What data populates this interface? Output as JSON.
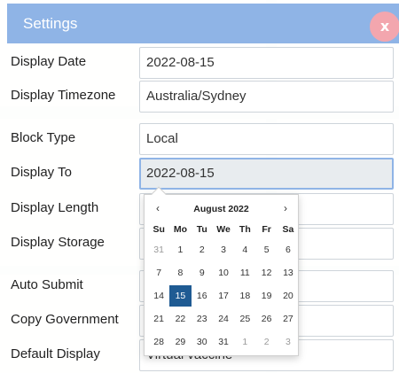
{
  "dialog": {
    "title": "Settings",
    "close_label": "x"
  },
  "fields": [
    {
      "name": "display-date",
      "label": "Display Date",
      "value": "2022-08-15"
    },
    {
      "name": "display-timezone",
      "label": "Display Timezone",
      "value": "Australia/Sydney"
    },
    {
      "name": "block-type",
      "label": "Block Type",
      "value": "Local"
    },
    {
      "name": "display-to",
      "label": "Display To",
      "value": "2022-08-15"
    },
    {
      "name": "display-length",
      "label": "Display Length",
      "value": ""
    },
    {
      "name": "display-storage",
      "label": "Display Storage",
      "value": ""
    },
    {
      "name": "auto-submit",
      "label": "Auto Submit",
      "value": ""
    },
    {
      "name": "copy-government",
      "label": "Copy Government",
      "value": ""
    },
    {
      "name": "default-display",
      "label": "Default Display",
      "value": "Virtual vaccine"
    }
  ],
  "datepicker": {
    "prev": "‹",
    "next": "›",
    "month_label": "August 2022",
    "weekdays": [
      "Su",
      "Mo",
      "Tu",
      "We",
      "Th",
      "Fr",
      "Sa"
    ],
    "weeks": [
      [
        {
          "d": "31",
          "m": true
        },
        {
          "d": "1"
        },
        {
          "d": "2"
        },
        {
          "d": "3"
        },
        {
          "d": "4"
        },
        {
          "d": "5"
        },
        {
          "d": "6"
        }
      ],
      [
        {
          "d": "7"
        },
        {
          "d": "8"
        },
        {
          "d": "9"
        },
        {
          "d": "10"
        },
        {
          "d": "11"
        },
        {
          "d": "12"
        },
        {
          "d": "13"
        }
      ],
      [
        {
          "d": "14"
        },
        {
          "d": "15",
          "s": true
        },
        {
          "d": "16"
        },
        {
          "d": "17"
        },
        {
          "d": "18"
        },
        {
          "d": "19"
        },
        {
          "d": "20"
        }
      ],
      [
        {
          "d": "21"
        },
        {
          "d": "22"
        },
        {
          "d": "23"
        },
        {
          "d": "24"
        },
        {
          "d": "25"
        },
        {
          "d": "26"
        },
        {
          "d": "27"
        }
      ],
      [
        {
          "d": "28"
        },
        {
          "d": "29"
        },
        {
          "d": "30"
        },
        {
          "d": "31"
        },
        {
          "d": "1",
          "m": true
        },
        {
          "d": "2",
          "m": true
        },
        {
          "d": "3",
          "m": true
        }
      ]
    ]
  },
  "colors": {
    "titlebar": "#8fb4e6",
    "close": "#f3a6ae",
    "selected_day": "#1f5b93",
    "focus_border": "#8fb4e6"
  }
}
